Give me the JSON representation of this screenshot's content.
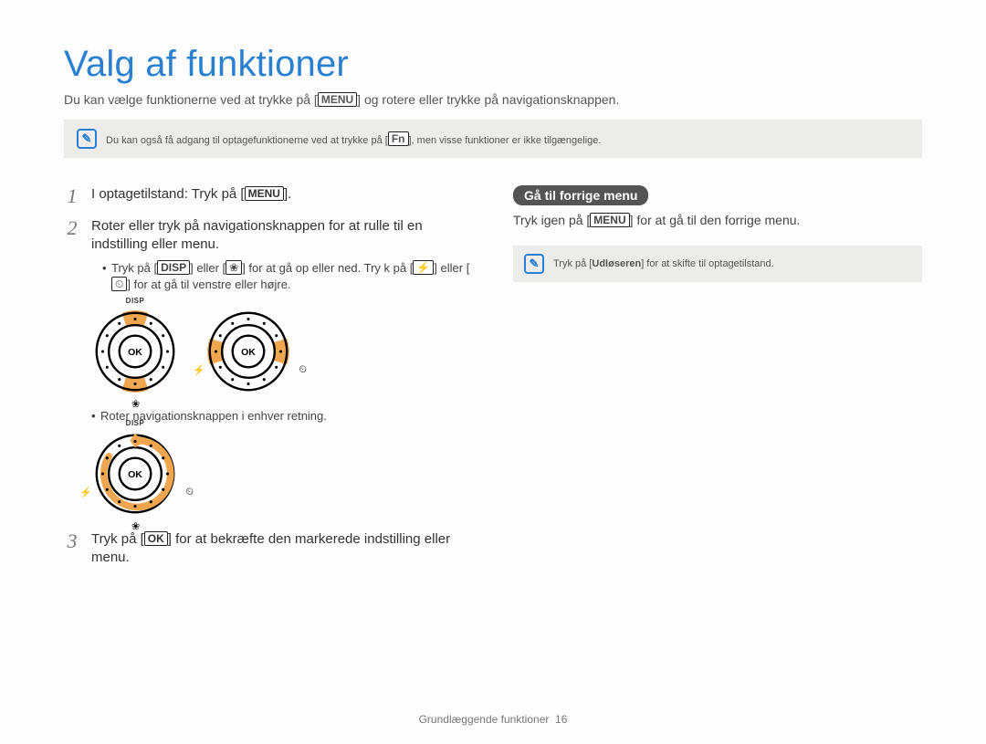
{
  "title": "Valg af funktioner",
  "subtitle_pre": "Du kan vælge funktionerne ved at trykke på [",
  "subtitle_btn": "MENU",
  "subtitle_post": "] og rotere eller trykke på navigationsknappen.",
  "intro_note_pre": "Du kan også få adgang til optagefunktionerne ved at trykke på [",
  "intro_note_btn": "Fn",
  "intro_note_post": "], men visse funktioner er ikke tilgængelige.",
  "steps": {
    "s1": {
      "num": "1",
      "pre": "I optagetilstand: Tryk på [",
      "btn": "MENU",
      "post": "]."
    },
    "s2": {
      "num": "2",
      "text": "Roter eller tryk på navigationsknappen for at rulle til en indstilling eller menu.",
      "bullet1_pre": "Tryk på [",
      "bullet1_b1": "DISP",
      "bullet1_mid1": "] eller [",
      "bullet1_b2": "❀",
      "bullet1_mid2": "] for at gå op eller ned. Try k på [",
      "bullet1_b3": "⚡",
      "bullet1_mid3": "] eller [",
      "bullet1_b4": "⏲",
      "bullet1_post": "] for at gå til venstre eller højre.",
      "bullet2": "Roter navigationsknappen i enhver retning.",
      "disp_label": "DISP",
      "ok_label": "OK"
    },
    "s3": {
      "num": "3",
      "pre": "Tryk på [",
      "btn": "OK",
      "post": "] for at bekræfte den markerede indstilling eller menu."
    }
  },
  "right": {
    "badge": "Gå til forrige menu",
    "line_pre": "Tryk igen på [",
    "line_btn": "MENU",
    "line_post": "] for at gå til den forrige menu.",
    "note_pre": "Tryk på [",
    "note_bold": "Udløseren",
    "note_post": "] for at skifte til optagetilstand."
  },
  "glyphs": {
    "flower": "❀",
    "flash": "⚡",
    "timer": "⏲"
  },
  "footer": {
    "chapter": "Grundlæggende funktioner",
    "page": "16"
  },
  "colors": {
    "accent": "#2a80d0",
    "highlight": "#f0a64e"
  }
}
